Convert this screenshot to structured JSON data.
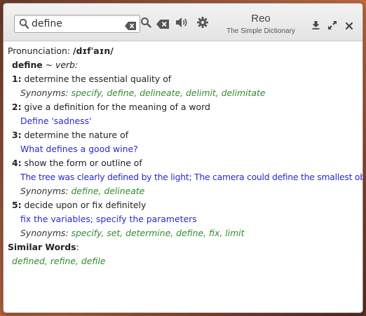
{
  "colors": {
    "synonym": "#2f8c2f",
    "example": "#2a2ad0",
    "header_bg": "#ececec"
  },
  "search": {
    "value": "define",
    "placeholder": ""
  },
  "app": {
    "title": "Reo",
    "subtitle": "The Simple Dictionary"
  },
  "icons": {
    "search": "search-icon",
    "clear": "backspace-icon",
    "lookup": "search-icon",
    "delete": "backspace-icon",
    "speak": "speaker-icon",
    "settings": "gear-icon",
    "download": "download-icon",
    "maximize": "maximize-icon",
    "close": "close-icon"
  },
  "entry": {
    "pronunciation_label": "Pronunciation:",
    "pronunciation": "/dɪfˈaɪn/",
    "word": "define",
    "separator": "~",
    "pos": "verb:",
    "synonyms_label": "Synonyms:",
    "senses": [
      {
        "num": "1:",
        "def": "determine the essential quality of",
        "syn_parts": [
          "specify",
          ", ",
          "define",
          ", ",
          "delineate",
          ", ",
          "delimit",
          ", ",
          "delimitate"
        ]
      },
      {
        "num": "2:",
        "def": "give a definition for the meaning of a word",
        "example": "Define 'sadness'"
      },
      {
        "num": "3:",
        "def": "determine the nature of",
        "example": "What defines a good wine?"
      },
      {
        "num": "4:",
        "def": "show the form or outline of",
        "example": "The tree was clearly defined by the light; The camera could define the smallest object",
        "syn_parts": [
          "define",
          ", ",
          "delineate"
        ]
      },
      {
        "num": "5:",
        "def": "decide upon or fix definitely",
        "example": "fix the variables; specify the parameters",
        "syn_parts": [
          "specify",
          ", ",
          "set",
          ", ",
          "determine",
          ", ",
          "define",
          ", ",
          "fix",
          ", ",
          "limit"
        ]
      }
    ],
    "similar_label": "Similar Words",
    "similar_colon": ":",
    "similar_parts": [
      "defined",
      ", ",
      "refine",
      ", ",
      "defile"
    ]
  }
}
